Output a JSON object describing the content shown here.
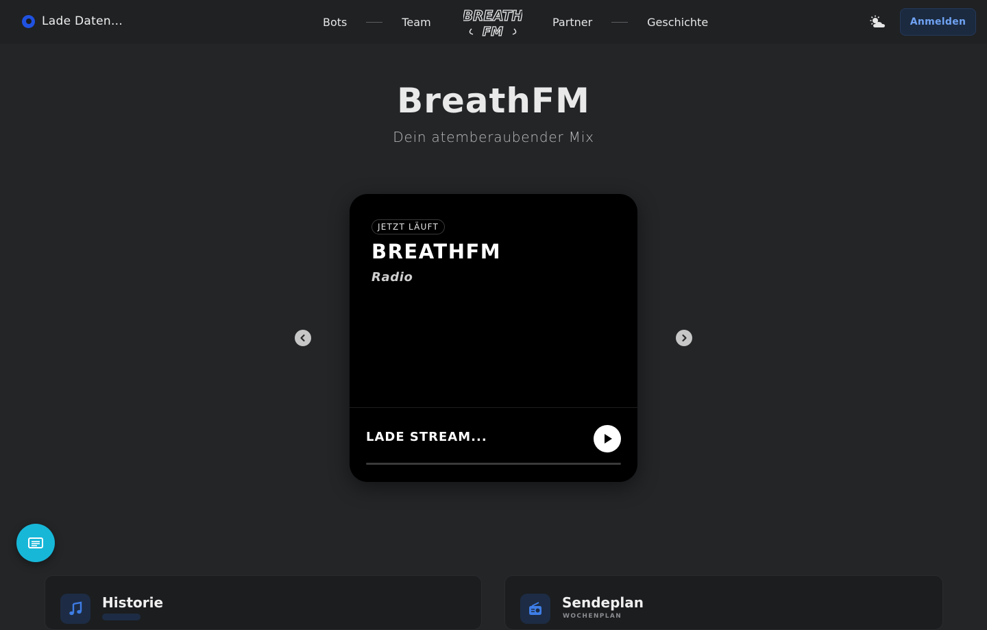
{
  "header": {
    "status_text": "Lade Daten...",
    "nav_left": [
      "Bots",
      "Team"
    ],
    "nav_right": [
      "Partner",
      "Geschichte"
    ],
    "logo_text_top": "BREATH",
    "logo_text_bottom": "FM",
    "login_label": "Anmelden",
    "weather_icon": "sun-cloud-icon"
  },
  "hero": {
    "title": "BreathFM",
    "subtitle": "Dein atemberaubender Mix"
  },
  "player": {
    "badge": "JETZT LÄUFT",
    "title": "BREATHFM",
    "subtitle": "Radio",
    "stream_label": "LADE STREAM...",
    "progress": 0
  },
  "panels": [
    {
      "title": "Historie",
      "subtitle": "",
      "icon": "music-note-icon"
    },
    {
      "title": "Sendeplan",
      "subtitle": "WOCHENPLAN",
      "icon": "radio-icon"
    }
  ],
  "colors": {
    "accent": "#17b7d8",
    "login_text": "#6fa2f2",
    "status_dot": "#2052e0"
  }
}
